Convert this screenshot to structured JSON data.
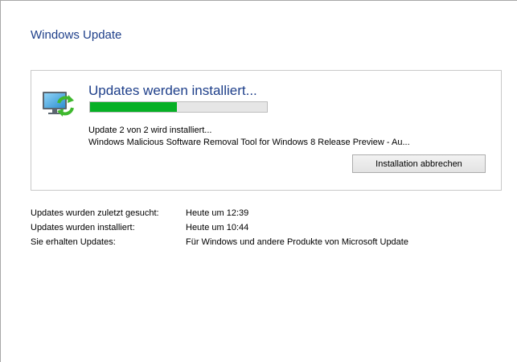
{
  "page": {
    "title": "Windows Update"
  },
  "status_panel": {
    "heading": "Updates werden installiert...",
    "progress_fraction": 0.49,
    "progress_color": "#06b025",
    "line1": "Update 2 von 2 wird installiert...",
    "line2": "Windows Malicious Software Removal Tool for Windows 8 Release Preview - Au...",
    "cancel_label": "Installation abbrechen",
    "icon": "update-monitor-icon"
  },
  "info": {
    "rows": [
      {
        "label": "Updates wurden zuletzt gesucht:",
        "value": "Heute um 12:39"
      },
      {
        "label": "Updates wurden installiert:",
        "value": "Heute um 10:44"
      },
      {
        "label": "Sie erhalten Updates:",
        "value": "Für Windows und andere Produkte von Microsoft Update"
      }
    ]
  },
  "colors": {
    "title": "#1e3f8a",
    "panel_border": "#c9c9c9"
  }
}
